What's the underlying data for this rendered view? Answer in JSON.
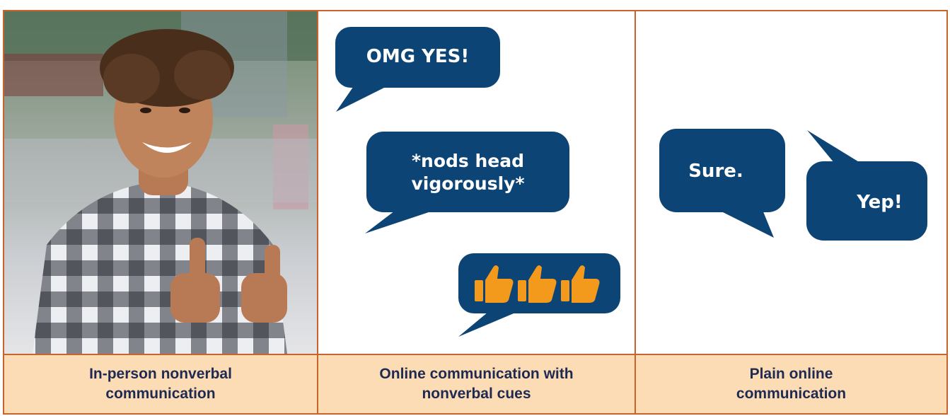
{
  "columns": [
    {
      "caption": "In-person nonverbal\ncommunication",
      "image": "smiling-teen-giving-thumbs-up-photo"
    },
    {
      "caption": "Online communication with\nnonverbal cues",
      "bubbles": [
        {
          "text": "OMG YES!"
        },
        {
          "text": "*nods head\nvigorously*"
        },
        {
          "icons": [
            "thumbs-up-icon",
            "thumbs-up-icon",
            "thumbs-up-icon"
          ]
        }
      ]
    },
    {
      "caption": "Plain online\ncommunication",
      "bubbles": [
        {
          "text": "Sure."
        },
        {
          "text": "Yep!"
        }
      ]
    }
  ],
  "colors": {
    "bubble": "#0d4476",
    "thumb": "#f39a1c",
    "border": "#c8642a",
    "caption_band": "#fcdcb4",
    "caption_text": "#1f2a52"
  }
}
